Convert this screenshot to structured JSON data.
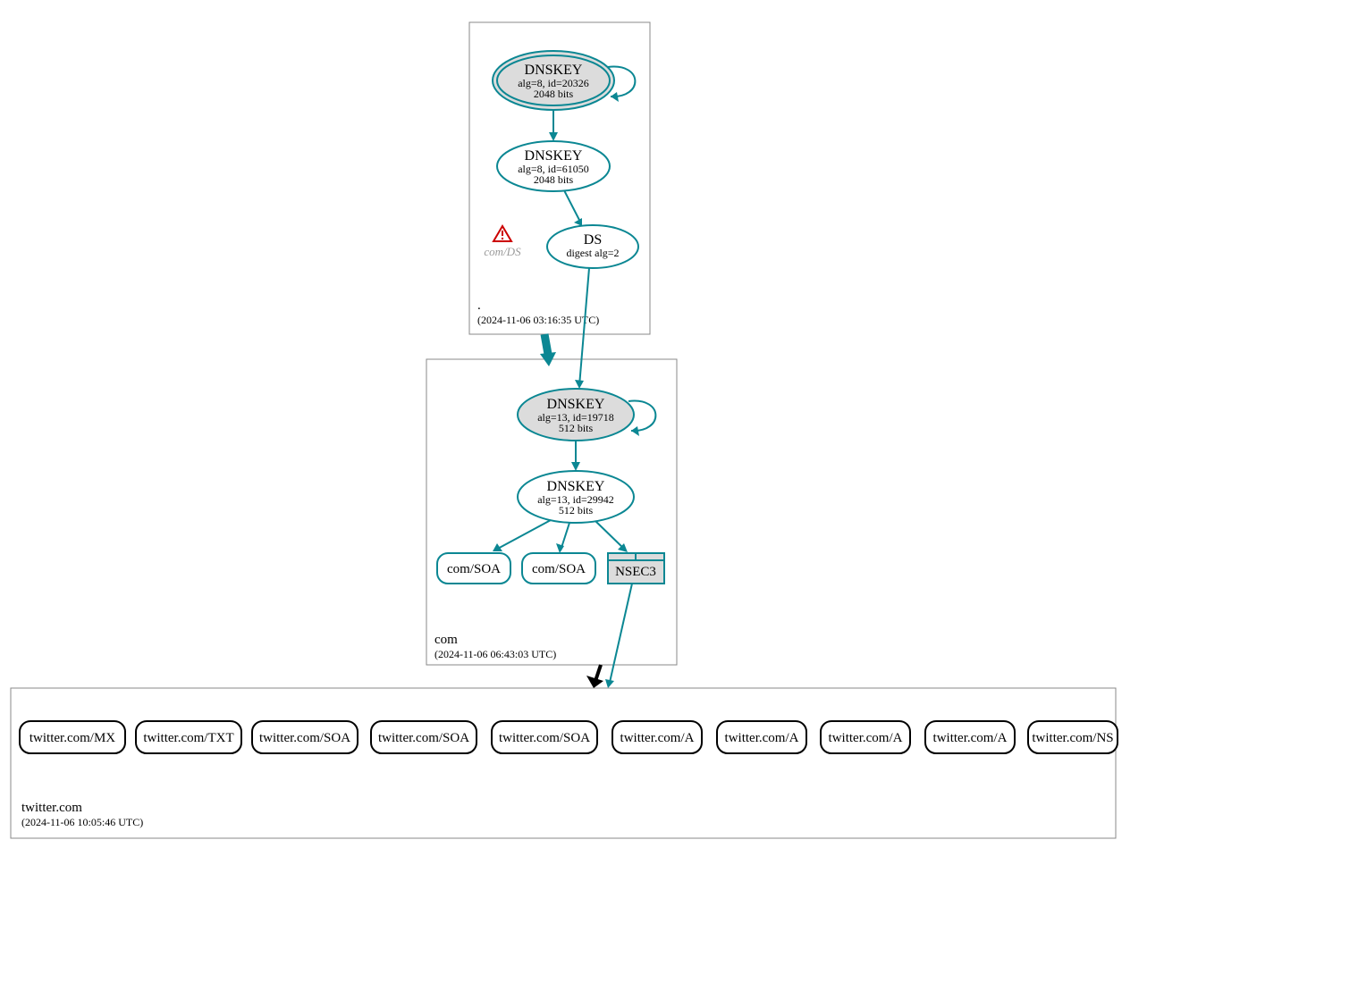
{
  "zones": {
    "root": {
      "label": ".",
      "timestamp": "(2024-11-06 03:16:35 UTC)"
    },
    "com": {
      "label": "com",
      "timestamp": "(2024-11-06 06:43:03 UTC)"
    },
    "twitter": {
      "label": "twitter.com",
      "timestamp": "(2024-11-06 10:05:46 UTC)"
    }
  },
  "nodes": {
    "root_ksk": {
      "title": "DNSKEY",
      "line2": "alg=8, id=20326",
      "line3": "2048 bits"
    },
    "root_zsk": {
      "title": "DNSKEY",
      "line2": "alg=8, id=61050",
      "line3": "2048 bits"
    },
    "root_ds": {
      "title": "DS",
      "line2": "digest alg=2"
    },
    "root_warn": {
      "label": "com/DS"
    },
    "com_ksk": {
      "title": "DNSKEY",
      "line2": "alg=13, id=19718",
      "line3": "512 bits"
    },
    "com_zsk": {
      "title": "DNSKEY",
      "line2": "alg=13, id=29942",
      "line3": "512 bits"
    },
    "com_soa1": {
      "label": "com/SOA"
    },
    "com_soa2": {
      "label": "com/SOA"
    },
    "com_nsec3": {
      "label": "NSEC3"
    }
  },
  "twitter_records": [
    "twitter.com/MX",
    "twitter.com/TXT",
    "twitter.com/SOA",
    "twitter.com/SOA",
    "twitter.com/SOA",
    "twitter.com/A",
    "twitter.com/A",
    "twitter.com/A",
    "twitter.com/A",
    "twitter.com/NS"
  ]
}
